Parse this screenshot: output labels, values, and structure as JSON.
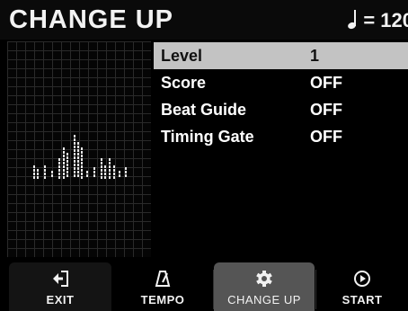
{
  "header": {
    "title": "CHANGE UP",
    "tempo": "= 120"
  },
  "settings": [
    {
      "label": "Level",
      "value": "1"
    },
    {
      "label": "Score",
      "value": "OFF"
    },
    {
      "label": "Beat Guide",
      "value": "OFF"
    },
    {
      "label": "Timing Gate",
      "value": "OFF"
    }
  ],
  "footer": {
    "exit": "EXIT",
    "tempo": "TEMPO",
    "change_up": "CHANGE UP",
    "start": "START"
  },
  "colors": {
    "selected_row": "#c3c3c3",
    "active_tab": "#555555"
  }
}
